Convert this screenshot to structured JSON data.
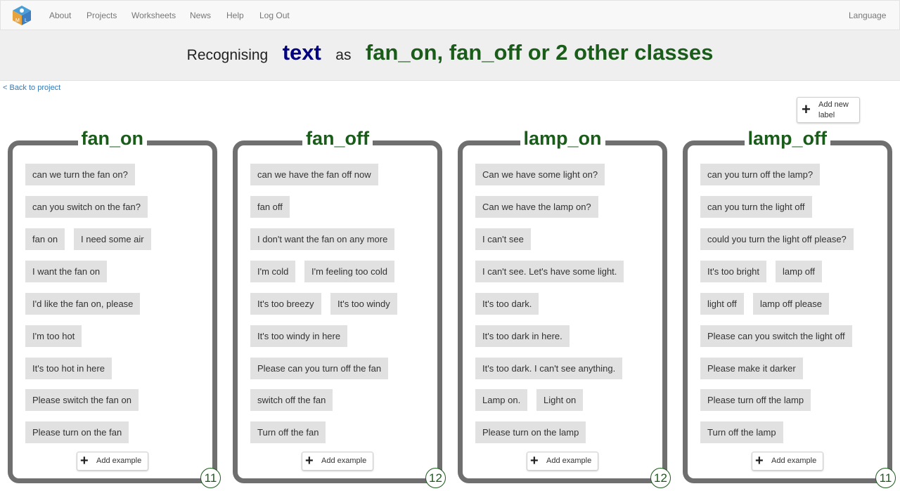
{
  "nav": {
    "logo_icon": "machine-learning-for-kids-logo",
    "links": [
      "About",
      "Projects",
      "Worksheets",
      "News",
      "Help",
      "Log Out"
    ],
    "language": "Language"
  },
  "title": {
    "recognising": "Recognising",
    "type": "text",
    "as": "as",
    "classes": "fan_on, fan_off or 2 other classes"
  },
  "back_link": "< Back to project",
  "add_label_button": "Add new label",
  "add_example_label": "Add example",
  "colors": {
    "label_green": "#1a5c1a",
    "type_blue": "#000080",
    "bucket_border": "#6f6f6f",
    "example_bg": "#e1e1e1"
  },
  "labels": [
    {
      "name": "fan_on",
      "count": "11",
      "examples": [
        "can we turn the fan on?",
        "can you switch on the fan?",
        "fan on",
        "I need some air",
        "I want the fan on",
        "I'd like the fan on, please",
        "I'm too hot",
        "It's too hot in here",
        "Please switch the fan on",
        "Please turn on the fan"
      ]
    },
    {
      "name": "fan_off",
      "count": "12",
      "examples": [
        "can we have the fan off now",
        "fan off",
        "I don't want the fan on any more",
        "I'm cold",
        "I'm feeling too cold",
        "It's too breezy",
        "It's too windy",
        "It's too windy in here",
        "Please can you turn off the fan",
        "switch off the fan",
        "Turn off the fan"
      ]
    },
    {
      "name": "lamp_on",
      "count": "12",
      "examples": [
        "Can we have some light on?",
        "Can we have the lamp on?",
        "I can't see",
        "I can't see. Let's have some light.",
        "It's too dark.",
        "It's too dark in here.",
        "It's too dark. I can't see anything.",
        "Lamp on.",
        "Light on",
        "Please turn on the lamp"
      ]
    },
    {
      "name": "lamp_off",
      "count": "11",
      "examples": [
        "can you turn off the lamp?",
        "can you turn the light off",
        "could you turn the light off please?",
        "It's too bright",
        "lamp off",
        "light off",
        "lamp off please",
        "Please can you switch the light off",
        "Please make it darker",
        "Please turn off the lamp",
        "Turn off the lamp"
      ]
    }
  ]
}
